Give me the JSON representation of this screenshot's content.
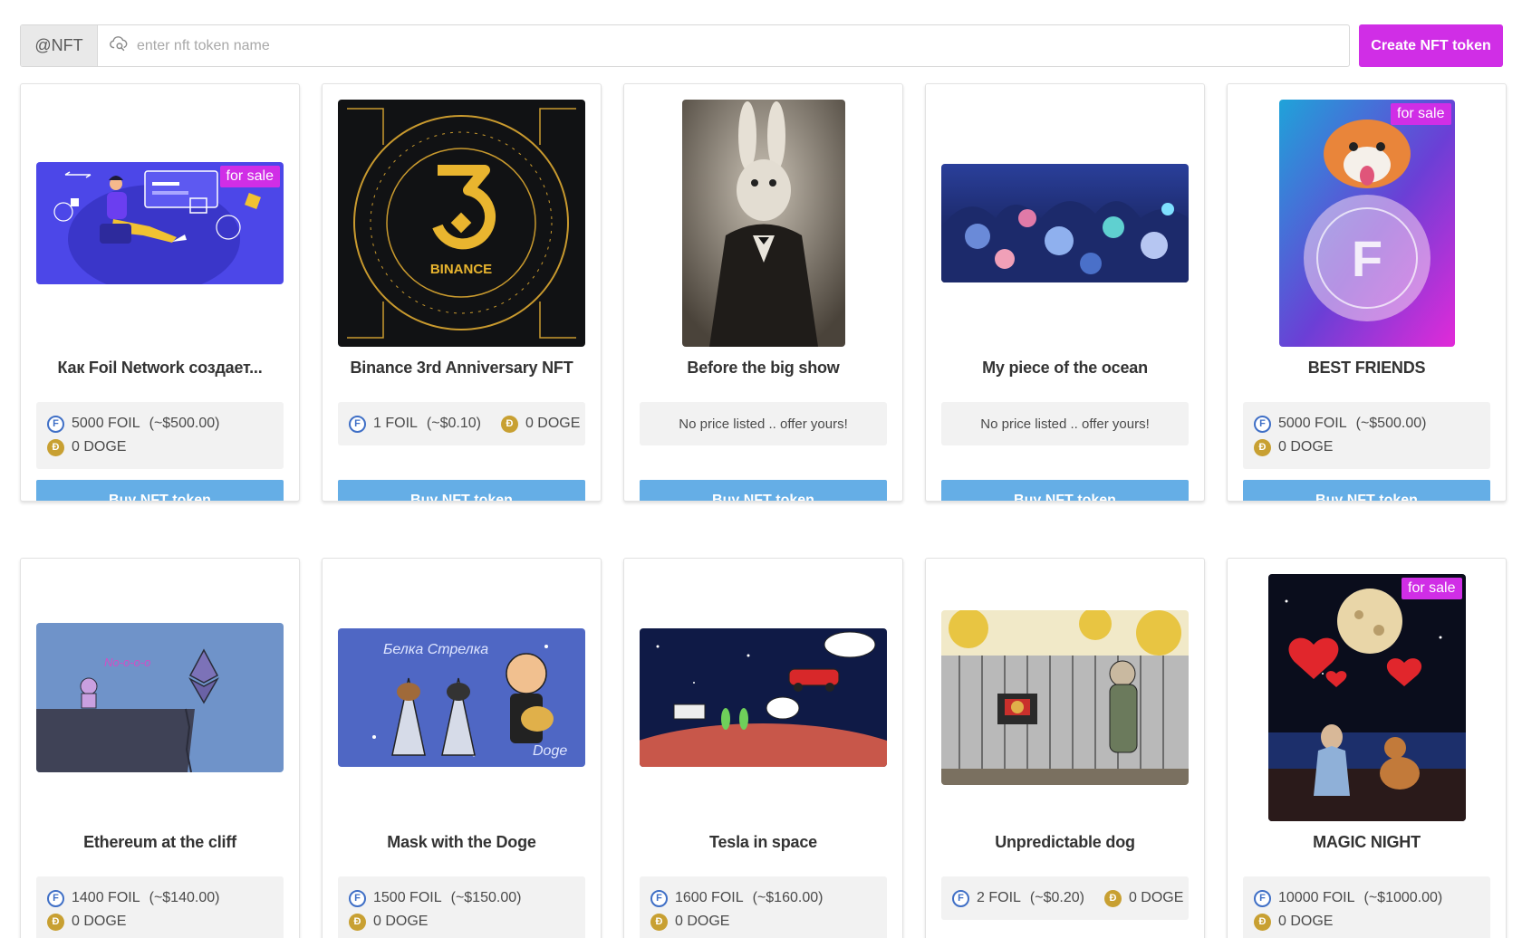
{
  "search": {
    "prefix": "@NFT",
    "placeholder": "enter nft token name",
    "value": ""
  },
  "create_label": "Create NFT token",
  "badge_label": "for sale",
  "no_price_text": "No price listed .. offer yours!",
  "buy_label": "Buy NFT token",
  "colors": {
    "accent": "#d02ee6",
    "buy": "#65aee6",
    "foil": "#3f6fc6",
    "doge": "#c8a032"
  },
  "cards": [
    {
      "title": "Как Foil Network создает...",
      "for_sale": true,
      "foil": "5000 FOIL",
      "usd": "(~$500.00)",
      "doge": "0 DOGE",
      "image": "foil-network-illustration"
    },
    {
      "title": "Binance 3rd Anniversary NFT",
      "for_sale": false,
      "foil": "1 FOIL",
      "usd": "(~$0.10)",
      "doge": "0 DOGE",
      "image": "binance-3-emblem",
      "logo_text": "BINANCE"
    },
    {
      "title": "Before the big show",
      "for_sale": false,
      "no_price": true,
      "image": "rabbit-portrait"
    },
    {
      "title": "My piece of the ocean",
      "for_sale": false,
      "no_price": true,
      "image": "coral-reef"
    },
    {
      "title": "BEST FRIENDS",
      "for_sale": true,
      "foil": "5000 FOIL",
      "usd": "(~$500.00)",
      "doge": "0 DOGE",
      "image": "dog-coin-art"
    },
    {
      "title": "Ethereum at the cliff",
      "for_sale": false,
      "foil": "1400 FOIL",
      "usd": "(~$140.00)",
      "doge": "0 DOGE",
      "image": "ethereum-cliff-cartoon"
    },
    {
      "title": "Mask with the Doge",
      "for_sale": false,
      "foil": "1500 FOIL",
      "usd": "(~$150.00)",
      "doge": "0 DOGE",
      "image": "rockets-cartoon"
    },
    {
      "title": "Tesla in space",
      "for_sale": false,
      "foil": "1600 FOIL",
      "usd": "(~$160.00)",
      "doge": "0 DOGE",
      "image": "tesla-space-cartoon"
    },
    {
      "title": "Unpredictable dog",
      "for_sale": false,
      "foil": "2 FOIL",
      "usd": "(~$0.20)",
      "doge": "0 DOGE",
      "image": "fence-dog-cartoon"
    },
    {
      "title": "MAGIC NIGHT",
      "for_sale": true,
      "foil": "10000 FOIL",
      "usd": "(~$1000.00)",
      "doge": "0 DOGE",
      "image": "moon-night-art"
    }
  ]
}
